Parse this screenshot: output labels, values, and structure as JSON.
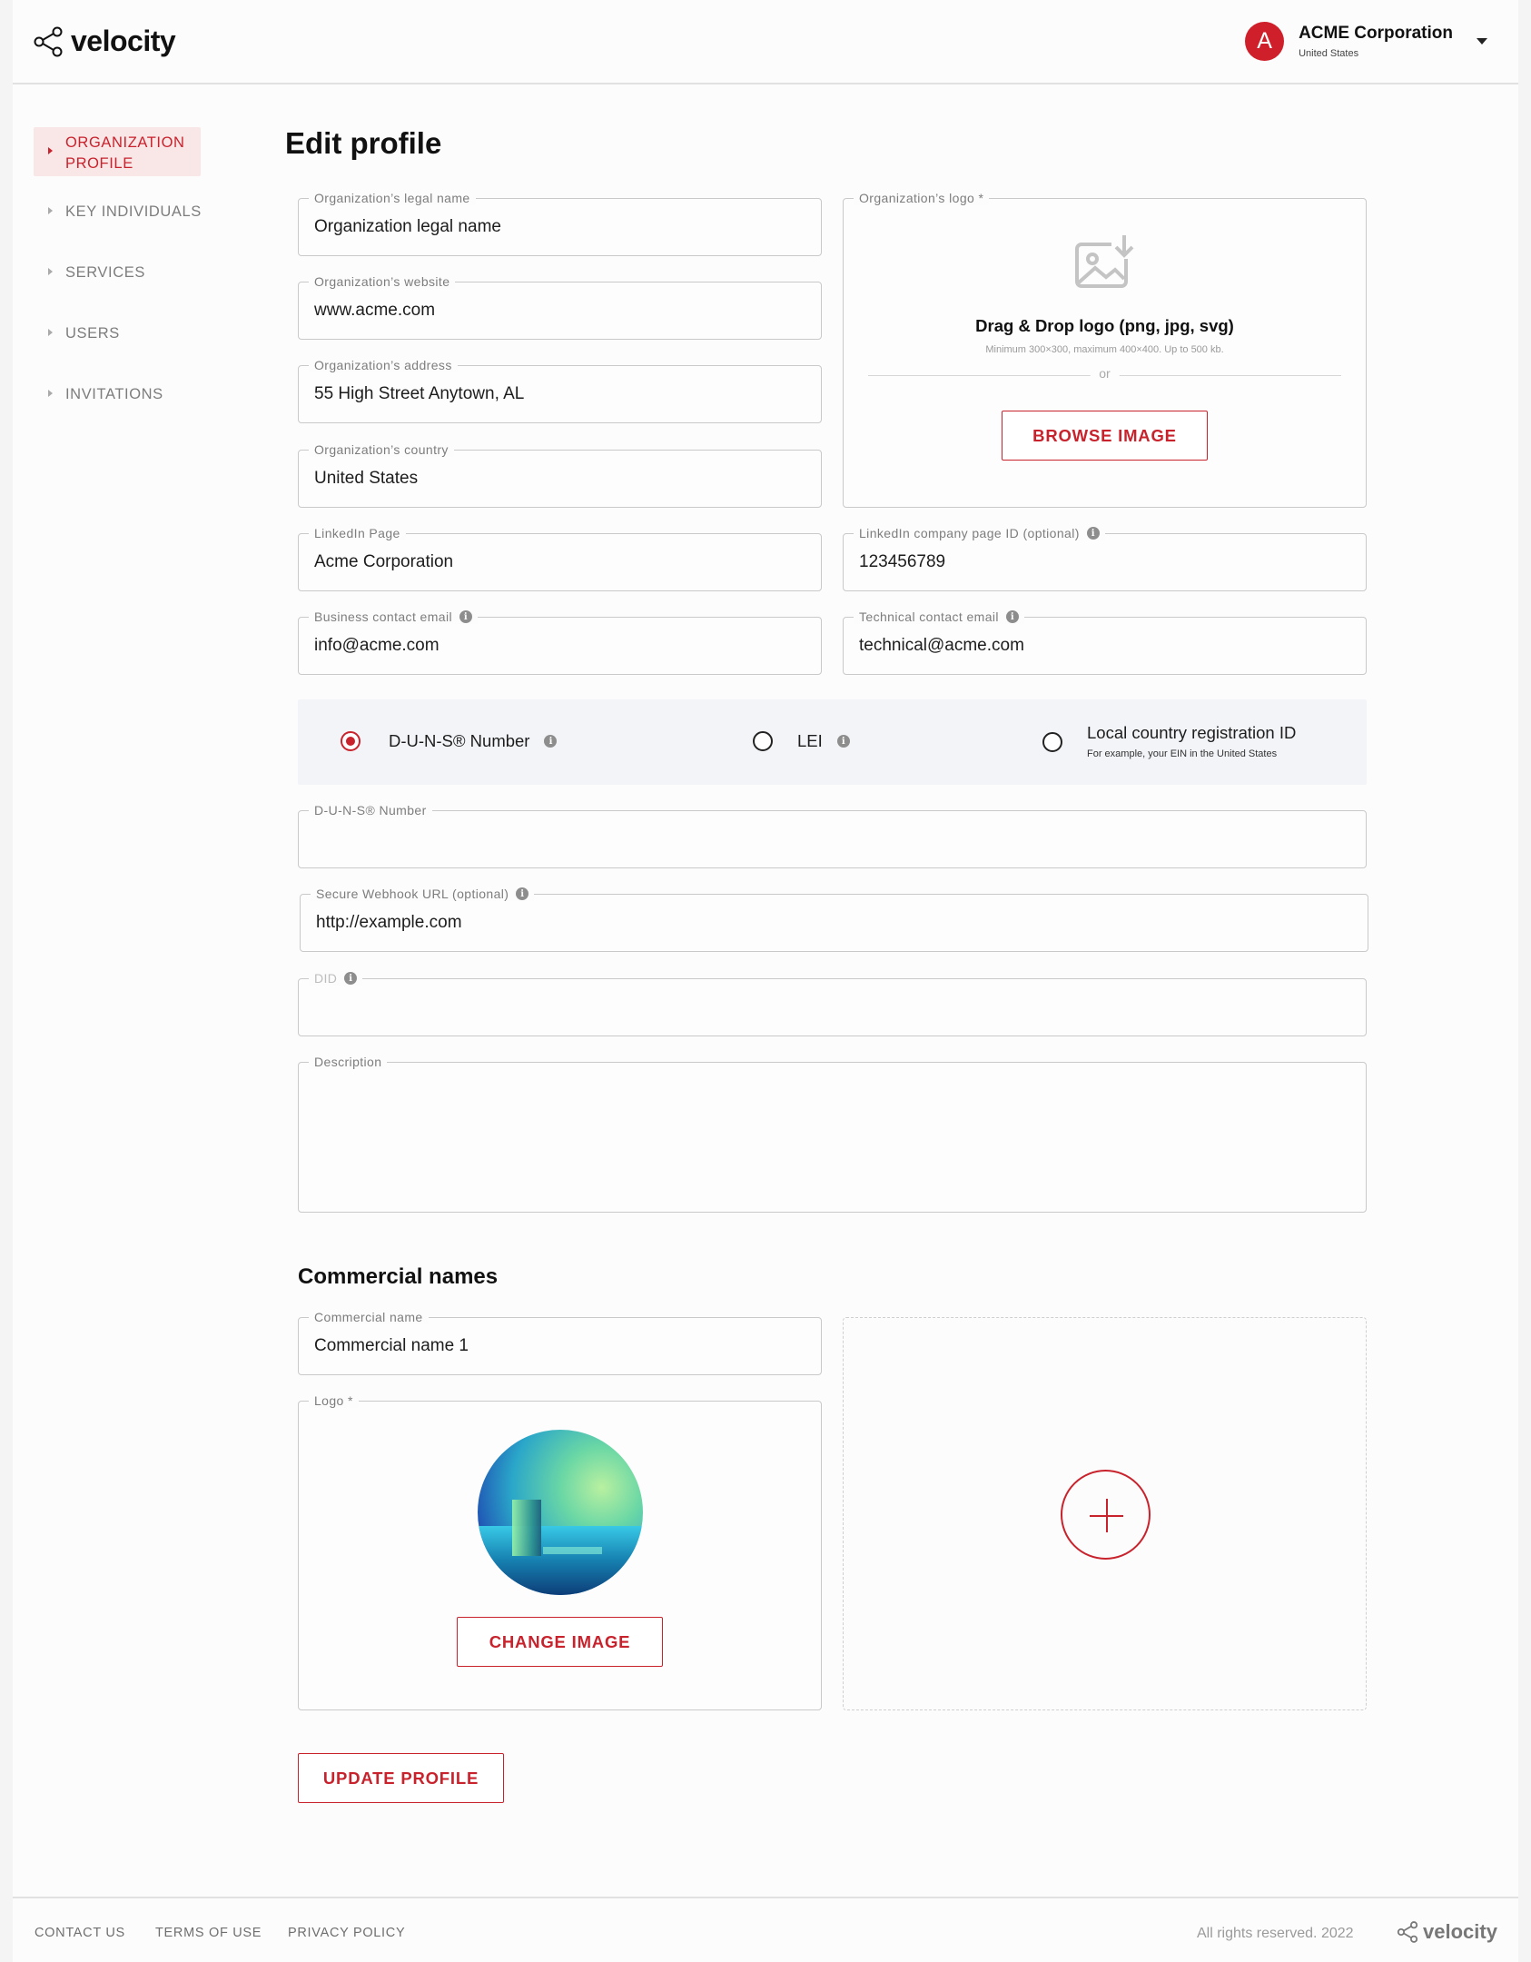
{
  "header": {
    "brand": "velocity",
    "account": {
      "initial": "A",
      "name": "ACME Corporation",
      "country": "United States"
    }
  },
  "sidebar": {
    "items": [
      {
        "label": "ORGANIZATION PROFILE",
        "active": true
      },
      {
        "label": "KEY INDIVIDUALS"
      },
      {
        "label": "SERVICES"
      },
      {
        "label": "USERS"
      },
      {
        "label": "INVITATIONS"
      }
    ]
  },
  "page": {
    "title": "Edit profile"
  },
  "form": {
    "legal_name": {
      "label": "Organization’s legal name",
      "value": "Organization legal name"
    },
    "website": {
      "label": "Organization’s website",
      "value": "www.acme.com"
    },
    "address": {
      "label": "Organization’s address",
      "value": "55 High Street Anytown, AL"
    },
    "country": {
      "label": "Organization’s country",
      "value": "United States"
    },
    "linkedin": {
      "label": "LinkedIn Page",
      "value": "Acme Corporation"
    },
    "linkedin_id": {
      "label": "LinkedIn company page ID (optional)",
      "value": "123456789"
    },
    "business_email": {
      "label": "Business contact email",
      "value": "info@acme.com"
    },
    "technical_email": {
      "label": "Technical contact email",
      "value": "technical@acme.com"
    },
    "logo": {
      "label": "Organization’s logo *",
      "drop_title": "Drag & Drop logo (png, jpg, svg)",
      "drop_sub": "Minimum 300×300, maximum 400×400. Up to 500 kb.",
      "or": "or",
      "browse": "BROWSE IMAGE"
    },
    "id_types": {
      "duns": "D-U-N-S® Number",
      "lei": "LEI",
      "local": "Local country registration ID",
      "local_sub": "For example, your EIN in the United States",
      "selected": "duns"
    },
    "duns_number": {
      "label": "D-U-N-S® Number",
      "value": ""
    },
    "webhook": {
      "label": "Secure Webhook URL  (optional)",
      "value": "http://example.com"
    },
    "did": {
      "label": "DID",
      "value": ""
    },
    "description": {
      "label": "Description",
      "value": ""
    }
  },
  "commercial": {
    "title": "Commercial names",
    "name": {
      "label": "Commercial name",
      "value": "Commercial name 1"
    },
    "logo": {
      "label": "Logo *",
      "change": "CHANGE IMAGE"
    }
  },
  "actions": {
    "update": "UPDATE PROFILE"
  },
  "footer": {
    "links": [
      "CONTACT US",
      "TERMS OF USE",
      "PRIVACY POLICY"
    ],
    "copyright": "All rights reserved. 2022",
    "brand": "velocity"
  },
  "colors": {
    "accent": "#c8232d",
    "avatar": "#cf1f2a",
    "band": "#f3f4f8"
  },
  "icons": [
    "share-logo-icon",
    "image-upload-icon",
    "info-icon",
    "plus-icon",
    "chevron-down-icon"
  ]
}
